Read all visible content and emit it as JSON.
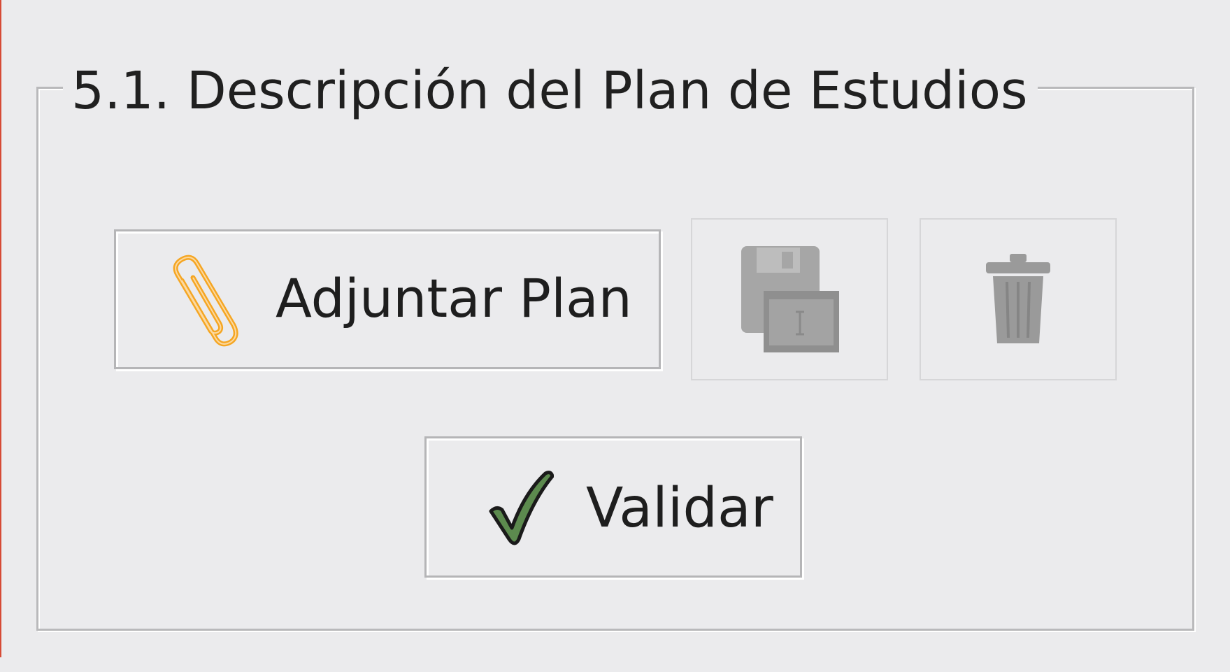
{
  "panel": {
    "title": "5.1. Descripción del Plan de Estudios"
  },
  "buttons": {
    "attach": {
      "label": "Adjuntar Plan",
      "icon": "paperclip-icon"
    },
    "save": {
      "icon": "save-disk-icon",
      "enabled": false
    },
    "delete": {
      "icon": "trash-icon",
      "enabled": false
    },
    "validate": {
      "label": "Validar",
      "icon": "checkmark-icon"
    }
  },
  "colors": {
    "background": "#ebebed",
    "paperclip": "#f5a623",
    "checkmark": "#5c8a4e",
    "disabled_icon": "#9a9a9a"
  }
}
